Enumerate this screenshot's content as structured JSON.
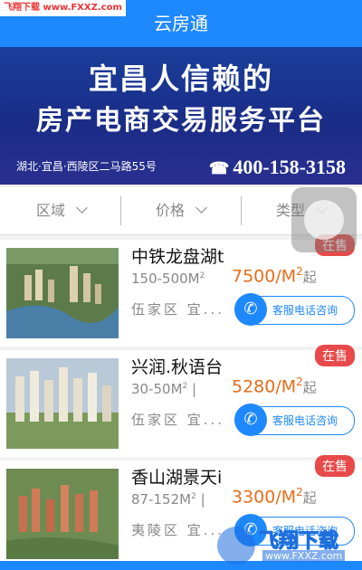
{
  "watermark": {
    "top_text": "飞翔下载 www.FXXZ.com",
    "bottom_title": "飞翔下载",
    "bottom_url": "www.FXXZ.com"
  },
  "header": {
    "title": "云房通"
  },
  "banner": {
    "line1": "宜昌人信赖的",
    "line2": "房产电商交易服务平台",
    "address": "湖北·宜昌·西陵区二马路55号",
    "phone": "400-158-3158",
    "phone_icon": "phone-icon"
  },
  "filters": [
    {
      "label": "区域"
    },
    {
      "label": "价格"
    },
    {
      "label": "类型"
    }
  ],
  "listings": [
    {
      "name": "中铁龙盘湖t",
      "area": "150-500M",
      "area_sup": "2",
      "price": "7500/M",
      "price_sup": "2",
      "price_unit": "起",
      "district": "伍家区 宜...",
      "badge": "在售",
      "call_label": "客服电话咨询",
      "thumb_tone": "#7a8a60"
    },
    {
      "name": "兴润.秋语台",
      "area": "30-50M",
      "area_sup": "2",
      "area_sep": "|",
      "price": "5280/M",
      "price_sup": "2",
      "price_unit": "起",
      "district": "伍家区 宜...",
      "badge": "在售",
      "call_label": "客服电话咨询",
      "thumb_tone": "#9aa486"
    },
    {
      "name": "香山湖景天i",
      "area": "87-152M",
      "area_sup": "2",
      "area_sep": "|",
      "price": "3300/M",
      "price_sup": "2",
      "price_unit": "起",
      "district": "夷陵区 宜...",
      "badge": "在售",
      "call_label": "客服电话咨询",
      "thumb_tone": "#6f7d58"
    }
  ],
  "colors": {
    "accent": "#1e88ff",
    "price": "#e86d19",
    "badge": "#e84a4a"
  }
}
